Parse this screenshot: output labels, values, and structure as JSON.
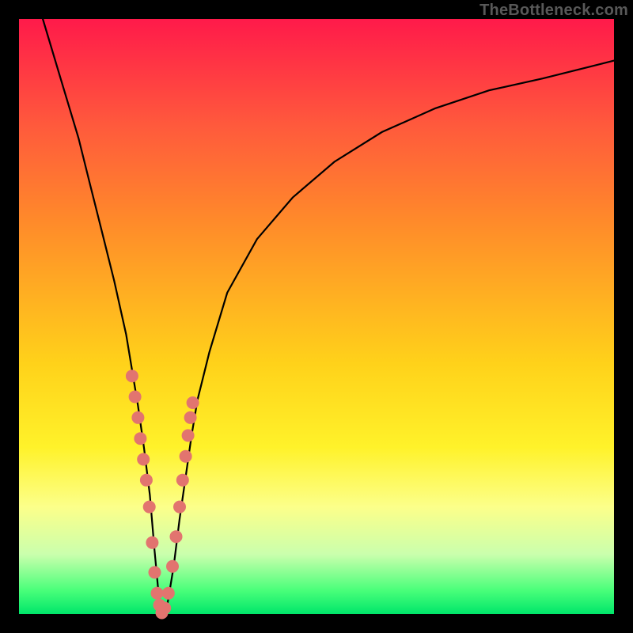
{
  "watermark": "TheBottleneck.com",
  "colors": {
    "gradient_top": "#ff1a4a",
    "gradient_bottom": "#00e66a",
    "curve": "#000000",
    "marker": "#e2746f",
    "page_bg": "#000000"
  },
  "chart_data": {
    "type": "line",
    "title": "",
    "xlabel": "",
    "ylabel": "",
    "xlim": [
      0,
      100
    ],
    "ylim": [
      0,
      100
    ],
    "grid": false,
    "note": "Axes show relative hardware balance (x) vs bottleneck % (y). Values estimated from pixel positions; no tick labels are rendered.",
    "series": [
      {
        "name": "bottleneck-curve",
        "x": [
          4,
          7,
          10,
          12,
          14,
          16,
          18,
          19,
          20,
          21,
          22,
          22.75,
          23.5,
          24,
          25,
          26,
          27,
          28,
          29,
          30,
          32,
          35,
          40,
          46,
          53,
          61,
          70,
          79,
          88,
          96,
          100
        ],
        "y": [
          100,
          90,
          80,
          72,
          64,
          56,
          47,
          41,
          35,
          28,
          20,
          11,
          3,
          0,
          2,
          8,
          16,
          23,
          30,
          36,
          44,
          54,
          63,
          70,
          76,
          81,
          85,
          88,
          90,
          92,
          93
        ]
      }
    ],
    "markers": {
      "name": "highlighted-points",
      "x": [
        19.0,
        19.5,
        20.0,
        20.4,
        20.9,
        21.4,
        21.9,
        22.4,
        22.8,
        23.2,
        23.6,
        24.0,
        24.5,
        25.1,
        25.8,
        26.4,
        27.0,
        27.5,
        28.0,
        28.4,
        28.8,
        29.2
      ],
      "y": [
        40.0,
        36.5,
        33.0,
        29.5,
        26.0,
        22.5,
        18.0,
        12.0,
        7.0,
        3.5,
        1.5,
        0.2,
        1.0,
        3.5,
        8.0,
        13.0,
        18.0,
        22.5,
        26.5,
        30.0,
        33.0,
        35.5
      ]
    }
  }
}
